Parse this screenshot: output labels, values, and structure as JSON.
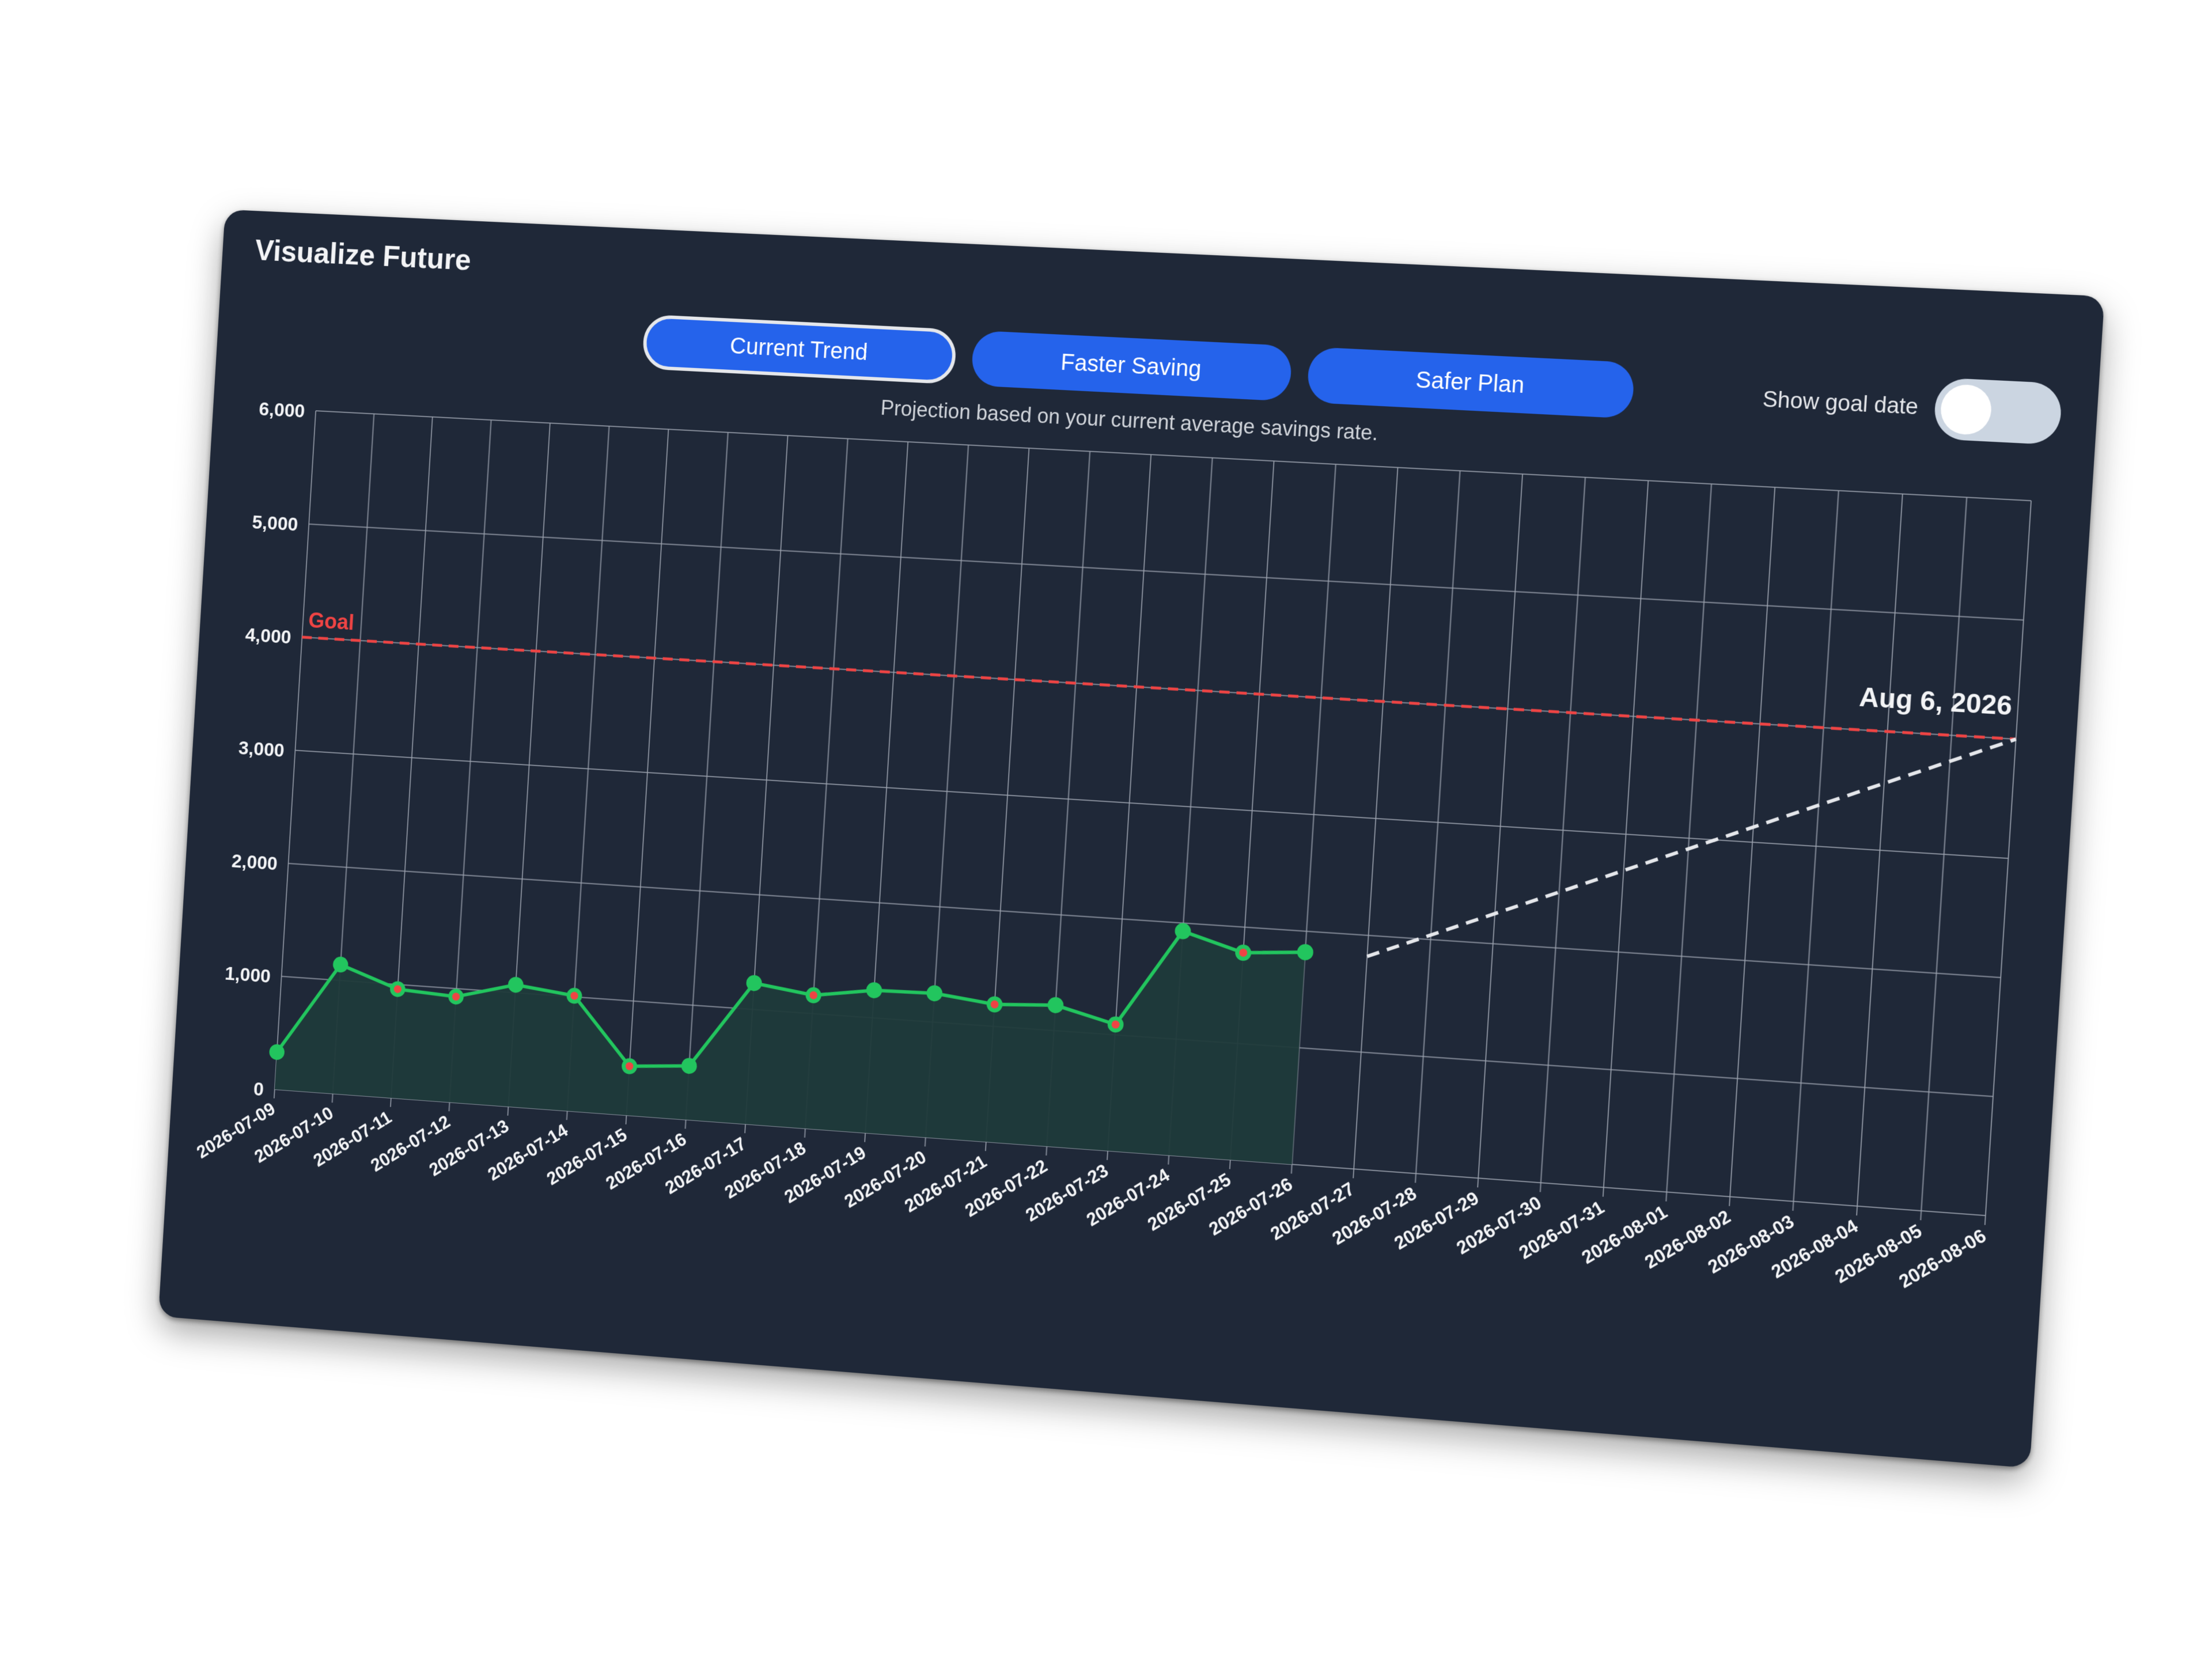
{
  "card": {
    "title": "Visualize Future"
  },
  "tabs": [
    {
      "label": "Current Trend",
      "active": true
    },
    {
      "label": "Faster Saving",
      "active": false
    },
    {
      "label": "Safer Plan",
      "active": false
    }
  ],
  "subtitle": "Projection based on your current average savings rate.",
  "toggle": {
    "label": "Show goal date",
    "on": false
  },
  "colors": {
    "background": "#1f2838",
    "actual_line": "#22c55e",
    "area_fill": "#1f3a3a",
    "goal_line": "#ef4444",
    "projection_line": "#e5e7eb",
    "down_marker": "#ef4444",
    "grid": "#9ca3af"
  },
  "chart_data": {
    "type": "line",
    "x": [
      "2026-07-09",
      "2026-07-10",
      "2026-07-11",
      "2026-07-12",
      "2026-07-13",
      "2026-07-14",
      "2026-07-15",
      "2026-07-16",
      "2026-07-17",
      "2026-07-18",
      "2026-07-19",
      "2026-07-20",
      "2026-07-21",
      "2026-07-22",
      "2026-07-23",
      "2026-07-24",
      "2026-07-25",
      "2026-07-26",
      "2026-07-27",
      "2026-07-28",
      "2026-07-29",
      "2026-07-30",
      "2026-07-31",
      "2026-08-01",
      "2026-08-02",
      "2026-08-03",
      "2026-08-04",
      "2026-08-05",
      "2026-08-06"
    ],
    "series": [
      {
        "values": [
          330,
          1140,
          960,
          930,
          1070,
          1010,
          430,
          470,
          1230,
          1160,
          1240,
          1250,
          1190,
          1220,
          1090,
          1930,
          1780,
          1820
        ]
      }
    ],
    "projection": {
      "from": "2026-07-27",
      "from_value": 1820,
      "to": "2026-08-06",
      "to_value": 4000
    },
    "goal": {
      "value": 4000,
      "label": "Goal"
    },
    "goal_date_label": "Aug 6, 2026",
    "yticks": [
      "0",
      "1,000",
      "2,000",
      "3,000",
      "4,000",
      "5,000",
      "6,000"
    ],
    "ylim": [
      0,
      6000
    ],
    "grid": true
  }
}
